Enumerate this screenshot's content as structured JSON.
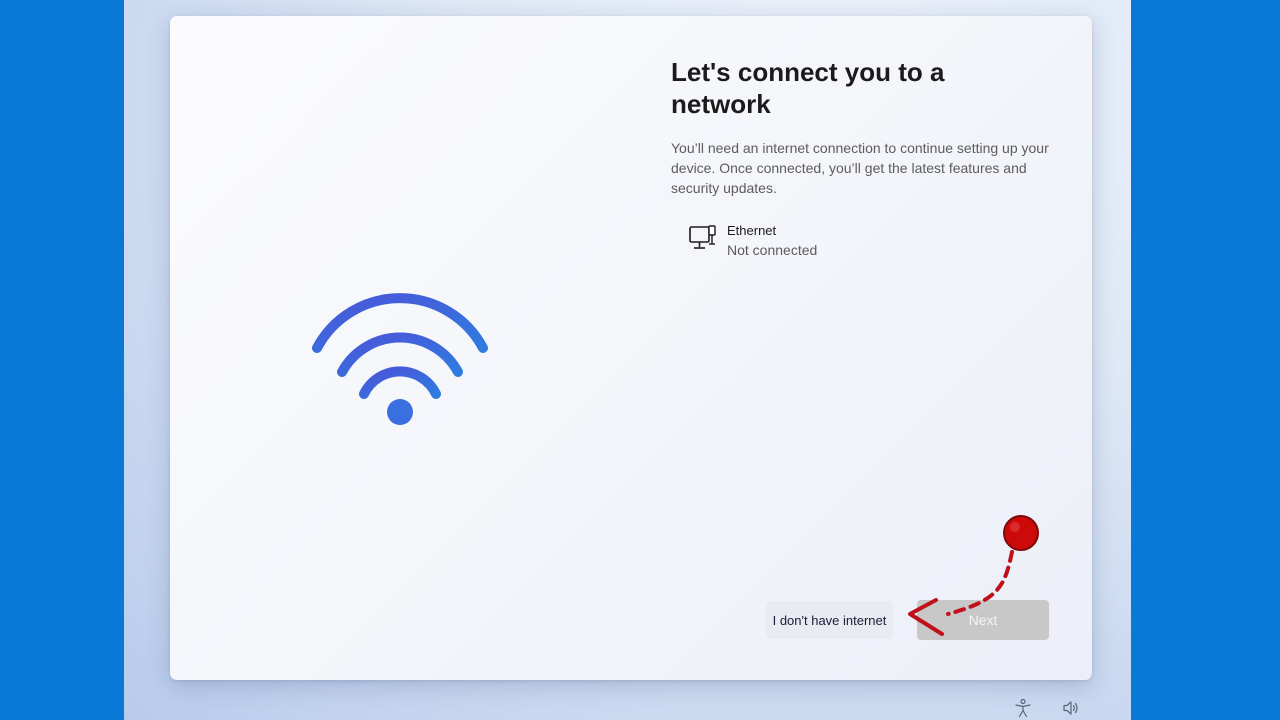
{
  "dialog": {
    "title": "Let's connect you to a network",
    "description": "You’ll need an internet connection to continue setting up your device. Once connected, you’ll get the latest features and security updates.",
    "illustration_icon": "wifi-icon",
    "accent_color": "#3f5bd8"
  },
  "networks": [
    {
      "icon": "ethernet-icon",
      "name": "Ethernet",
      "status": "Not connected"
    }
  ],
  "buttons": {
    "no_internet_label": "I don't have internet",
    "next_label": "Next",
    "next_enabled": false
  },
  "annotation": {
    "color": "#c0111a",
    "marker": "click-marker",
    "arrow_target": "I don't have internet"
  },
  "tray": {
    "icons": [
      "accessibility-icon",
      "volume-icon"
    ]
  },
  "colors": {
    "background_blue": "#0a78d6",
    "next_disabled_bg": "#c8c8c8"
  }
}
